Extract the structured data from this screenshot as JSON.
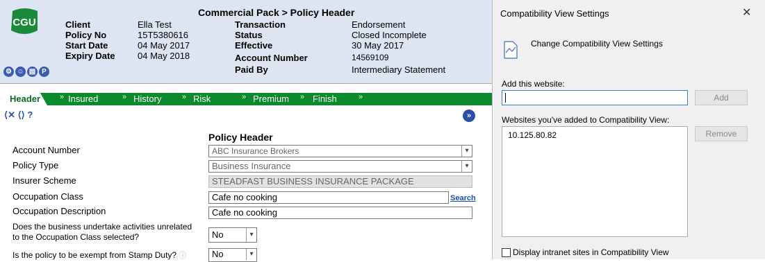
{
  "header": {
    "title": "Commercial Pack > Policy Header",
    "logo_text": "CGU",
    "fields_left": [
      {
        "label": "Client",
        "value": "Ella Test"
      },
      {
        "label": "Policy No",
        "value": "15T5380616"
      },
      {
        "label": "Start Date",
        "value": "04 May 2017"
      },
      {
        "label": "Expiry Date",
        "value": "04 May 2018"
      }
    ],
    "fields_right": [
      {
        "label": "Transaction",
        "value": "Endorsement"
      },
      {
        "label": "Status",
        "value": "Closed Incomplete"
      },
      {
        "label": "Effective",
        "value": "30 May 2017"
      },
      {
        "label": "Account Number",
        "value": "14569109"
      },
      {
        "label": "Paid By",
        "value": "Intermediary Statement"
      }
    ],
    "icons": [
      "settings-icon",
      "people-icon",
      "document-icon",
      "help-icon"
    ]
  },
  "tabs": [
    {
      "label": "Header"
    },
    {
      "label": "Insured"
    },
    {
      "label": "History"
    },
    {
      "label": "Risk"
    },
    {
      "label": "Premium"
    },
    {
      "label": "Finish"
    }
  ],
  "colors": {
    "tab_green": "#0a8a2c",
    "header_bg": "#dde4f2",
    "logo_green": "#1b8a3a"
  },
  "form": {
    "section_title": "Policy Header",
    "account_number": {
      "label": "Account Number",
      "value": "ABC Insurance Brokers"
    },
    "policy_type": {
      "label": "Policy Type",
      "value": "Business Insurance"
    },
    "insurer_scheme": {
      "label": "Insurer Scheme",
      "value": "STEADFAST BUSINESS INSURANCE PACKAGE"
    },
    "occupation_class": {
      "label": "Occupation Class",
      "value": "Cafe no cooking",
      "search_link": "Search"
    },
    "occupation_description": {
      "label": "Occupation Description",
      "value": "Cafe no cooking"
    },
    "unrelated_activities": {
      "label_line1": "Does the business undertake activities unrelated",
      "label_line2": "to the Occupation Class selected?",
      "value": "No"
    },
    "stamp_duty": {
      "label": "Is the policy to be exempt from Stamp Duty?",
      "value": "No"
    }
  },
  "dialog": {
    "title": "Compatibility View Settings",
    "close_glyph": "✕",
    "heading": "Change Compatibility View Settings",
    "add_label": "Add this website:",
    "add_value": "",
    "add_button": "Add",
    "list_label": "Websites you've added to Compatibility View:",
    "sites": [
      "10.125.80.82"
    ],
    "remove_button": "Remove",
    "checkbox_label": "Display intranet sites in Compatibility View",
    "checkbox_checked": false
  }
}
